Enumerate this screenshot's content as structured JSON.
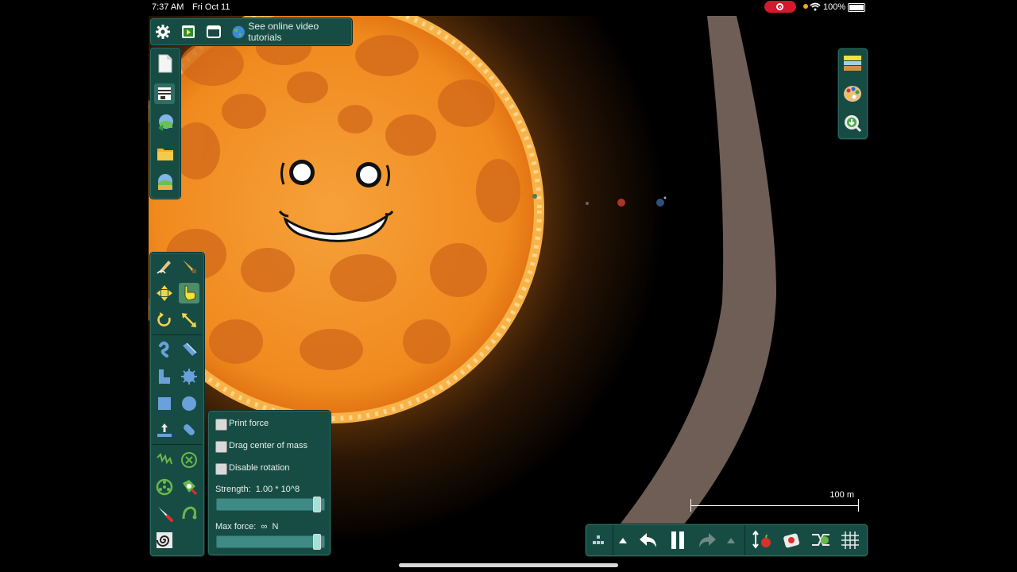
{
  "status": {
    "time": "7:37 AM",
    "date": "Fri Oct 11",
    "battery": "100%"
  },
  "top_toolbar": {
    "tutorials_label": "See online video tutorials"
  },
  "properties": {
    "print_force": "Print force",
    "drag_center": "Drag center of mass",
    "disable_rotation": "Disable rotation",
    "strength_label": "Strength:",
    "strength_value": "1.00 * 10^8",
    "strength_level": 0.97,
    "maxforce_label": "Max force:",
    "maxforce_value": "∞",
    "maxforce_unit": "N",
    "maxforce_level": 0.97
  },
  "scale": {
    "label": "100 m"
  },
  "colors": {
    "panel": "#174c44",
    "accent": "#2f6e62",
    "sun": "#f2891f"
  }
}
